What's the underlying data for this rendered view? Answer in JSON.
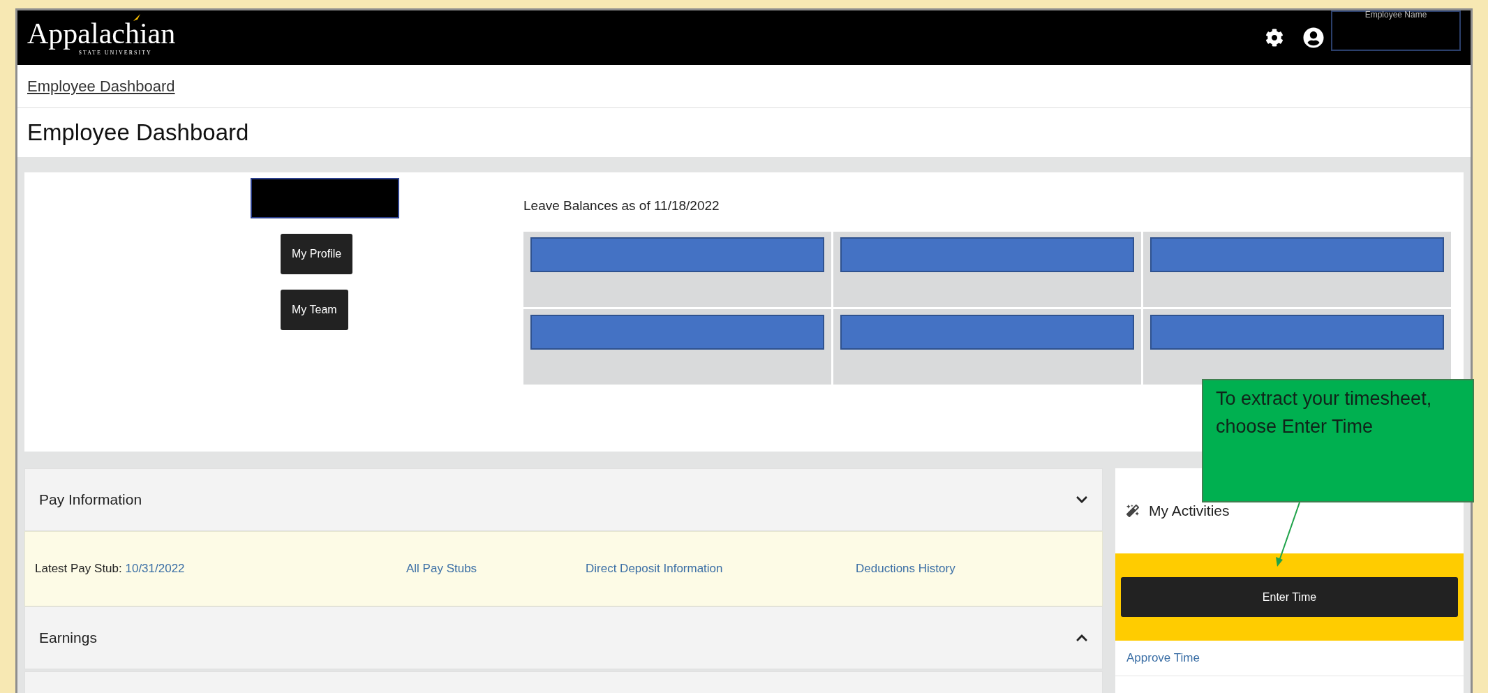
{
  "header": {
    "logo_text": "Appalachian",
    "logo_subtext": "STATE UNIVERSITY",
    "user_name": "Employee Name"
  },
  "breadcrumb": "Employee Dashboard",
  "page_title": "Employee Dashboard",
  "profile": {
    "buttons": [
      "My Profile",
      "My Team"
    ]
  },
  "leave_balances": {
    "title": "Leave Balances as of 11/18/2022",
    "cells": [
      {
        "kind": "redacted"
      },
      {
        "kind": "redacted"
      },
      {
        "kind": "redacted"
      },
      {
        "kind": "redacted"
      },
      {
        "kind": "redacted"
      },
      {
        "kind": "redacted"
      }
    ]
  },
  "pay_information": {
    "title": "Pay Information",
    "expanded": true,
    "latest_pay_stub_label": "Latest Pay Stub:",
    "latest_pay_stub_date": "10/31/2022",
    "links": [
      "All Pay Stubs",
      "Direct Deposit Information",
      "Deductions History"
    ]
  },
  "earnings": {
    "title": "Earnings",
    "expanded": false
  },
  "my_activities": {
    "title": "My Activities",
    "primary_button": "Enter Time",
    "links": [
      "Approve Time"
    ]
  },
  "callout": {
    "text": "To extract your timesheet, choose Enter Time"
  }
}
